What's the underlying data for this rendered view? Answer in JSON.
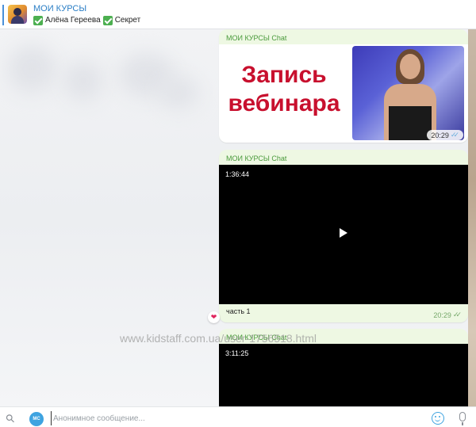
{
  "header": {
    "title": "МОИ КУРСЫ",
    "subtitle_name": "Алёна Гереева",
    "subtitle_tag": "Секрет"
  },
  "messages": [
    {
      "sender": "МОИ КУРСЫ Chat",
      "image_caption_line1": "Запись",
      "image_caption_line2": "вебинара",
      "time": "20:29"
    },
    {
      "sender": "МОИ КУРСЫ Chat",
      "video_duration": "1:36:44",
      "text": "часть 1",
      "time": "20:29",
      "reaction": "❤"
    },
    {
      "sender": "МОИ КУРСЫ Chat",
      "video_duration": "3:11:25"
    }
  ],
  "watermark": "www.kidstaff.com.ua/user-1756518.html",
  "composer": {
    "avatar_initials": "МС",
    "placeholder": "Анонимное сообщение..."
  },
  "colors": {
    "accent": "#2a7ec5",
    "sender": "#4a9a3b",
    "bubble": "#eef8e3",
    "caption_red": "#c8102e"
  }
}
